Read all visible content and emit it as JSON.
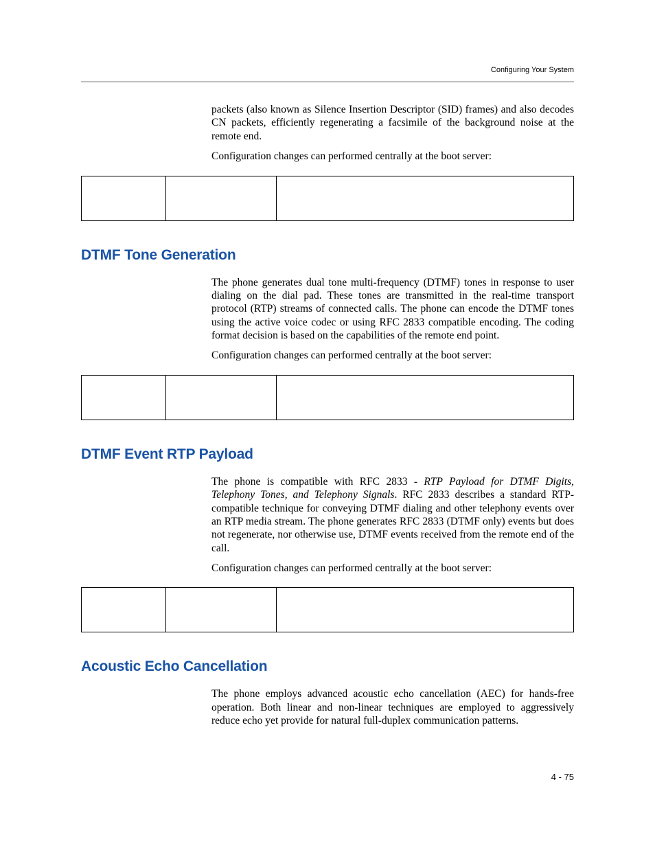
{
  "header": {
    "running_title": "Configuring Your System"
  },
  "intro": {
    "p1": "packets (also known as Silence Insertion Descriptor (SID) frames) and also decodes CN packets, efficiently regenerating a facsimile of the background noise at the remote end.",
    "p2": "Configuration changes can performed centrally at the boot server:"
  },
  "section1": {
    "heading": "DTMF Tone Generation",
    "p1": "The phone generates dual tone multi-frequency (DTMF) tones in response to user dialing on the dial pad. These tones are transmitted in the real-time transport protocol (RTP) streams of connected calls. The phone can encode the DTMF tones using the active voice codec or using RFC 2833 compatible encoding. The coding format decision is based on the capabilities of the remote end point.",
    "p2": "Configuration changes can performed centrally at the boot server:"
  },
  "section2": {
    "heading": "DTMF Event RTP Payload",
    "p1_a": "The phone is compatible with RFC 2833 - ",
    "p1_em": "RTP Payload for DTMF Digits, Telephony Tones, and Telephony Signals",
    "p1_b": ". RFC 2833 describes a standard RTP-compatible technique for conveying DTMF dialing and other telephony events over an RTP media stream. The phone generates RFC 2833 (DTMF only) events but does not regenerate, nor otherwise use, DTMF events received from the remote end of the call.",
    "p2": "Configuration changes can performed centrally at the boot server:"
  },
  "section3": {
    "heading": "Acoustic Echo Cancellation",
    "p1": "The phone employs advanced acoustic echo cancellation (AEC) for hands-free operation. Both linear and non-linear techniques are employed to aggressively reduce echo yet provide for natural full-duplex communication patterns."
  },
  "footer": {
    "page_number": "4 - 75"
  }
}
